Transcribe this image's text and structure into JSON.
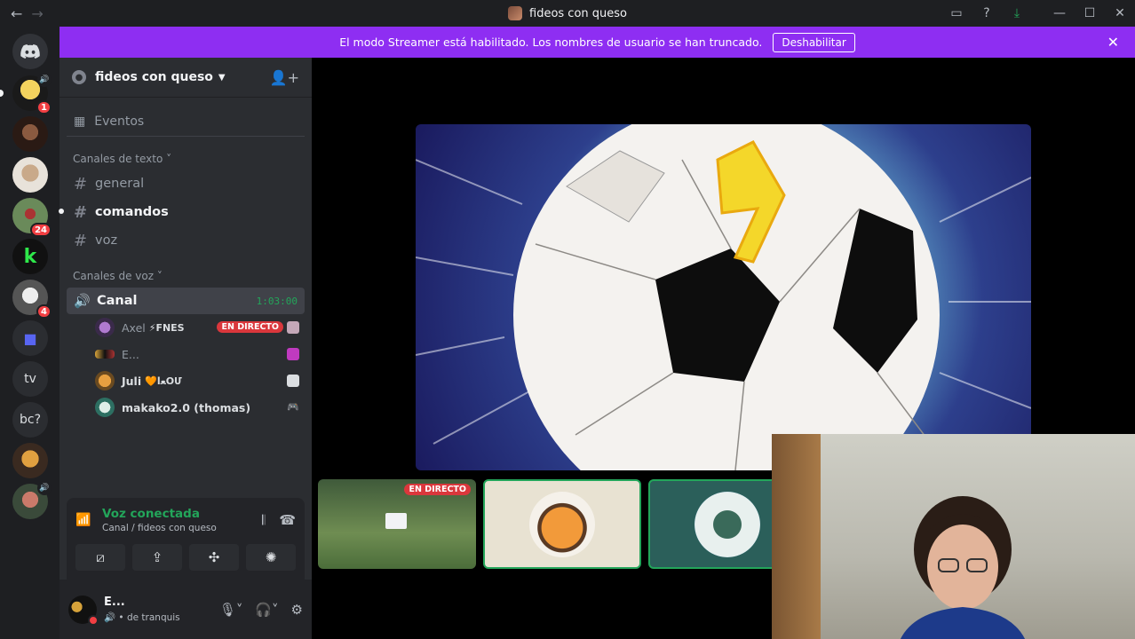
{
  "titlebar": {
    "title": "fideos con queso",
    "back_icon": "arrow-left-icon",
    "forward_icon": "arrow-right-icon"
  },
  "banner": {
    "message": "El modo Streamer está habilitado. Los nombres de usuario se han truncado.",
    "button_label": "Deshabilitar"
  },
  "rail": {
    "badges": [
      "1",
      "24",
      "4"
    ],
    "folder_labels": [
      "tv",
      "bc?"
    ]
  },
  "guild": {
    "name": "fideos con queso",
    "events_label": "Eventos",
    "text_category": "Canales de texto",
    "text_channels": [
      "general",
      "comandos",
      "voz"
    ],
    "voice_category": "Canales de voz",
    "voice_channel": "Canal",
    "voice_timer": "1:03:00",
    "voice_users": [
      {
        "name": "Axel",
        "tag": "⚡FNES",
        "live": "EN DIRECTO"
      },
      {
        "name": "E..."
      },
      {
        "name": "Juli",
        "tag": "🧡ﻌاОՄ"
      },
      {
        "name": "makako2.0 (thomas)"
      }
    ]
  },
  "voice_panel": {
    "status": "Voz conectada",
    "location": "Canal / fideos con queso"
  },
  "user_panel": {
    "name": "E...",
    "status_text": "de tranquis"
  },
  "stage": {
    "tile_live_label": "EN DIRECTO"
  },
  "colors": {
    "accent": "#8e2ef2",
    "online": "#23a55a",
    "live": "#da373c",
    "badge": "#f23f43"
  }
}
